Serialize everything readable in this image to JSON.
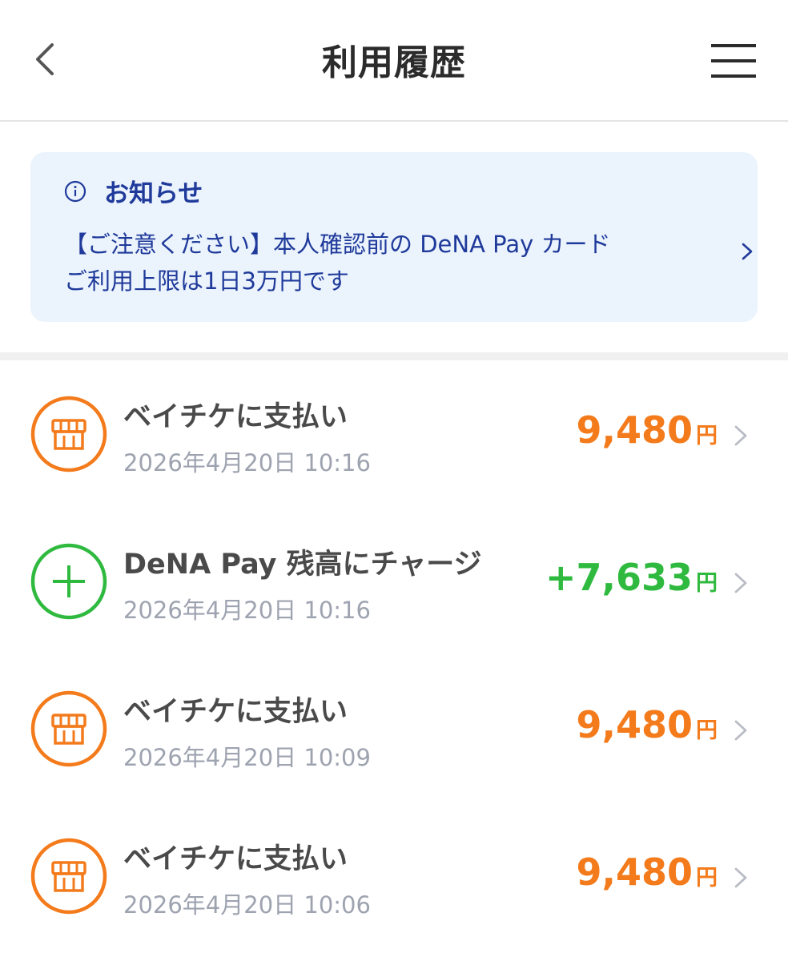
{
  "header": {
    "title": "利用履歴",
    "back_icon": "chevron-left-icon",
    "menu_icon": "hamburger-menu-icon"
  },
  "notice": {
    "icon": "info-icon",
    "title": "お知らせ",
    "line1": "【ご注意ください】本人確認前の DeNA Pay カード",
    "line2": "ご利用上限は1日3万円です",
    "color": "#1f3a9a",
    "background": "#ebf3fd"
  },
  "transactions": [
    {
      "icon": "store-icon",
      "title": "ベイチケに支払い",
      "date": "2026年4月20日 10:16",
      "amount": "9,480",
      "currency": "円",
      "kind": "payment"
    },
    {
      "icon": "plus-circle-icon",
      "title": "DeNA Pay 残高にチャージ",
      "date": "2026年4月20日 10:16",
      "amount": "+7,633",
      "currency": "円",
      "kind": "charge"
    },
    {
      "icon": "store-icon",
      "title": "ベイチケに支払い",
      "date": "2026年4月20日 10:09",
      "amount": "9,480",
      "currency": "円",
      "kind": "payment"
    },
    {
      "icon": "store-icon",
      "title": "ベイチケに支払い",
      "date": "2026年4月20日 10:06",
      "amount": "9,480",
      "currency": "円",
      "kind": "payment"
    }
  ],
  "colors": {
    "payment": "#f47b1c",
    "charge": "#2fba3f",
    "date": "#9ea3b0",
    "title": "#4a4a4a"
  }
}
